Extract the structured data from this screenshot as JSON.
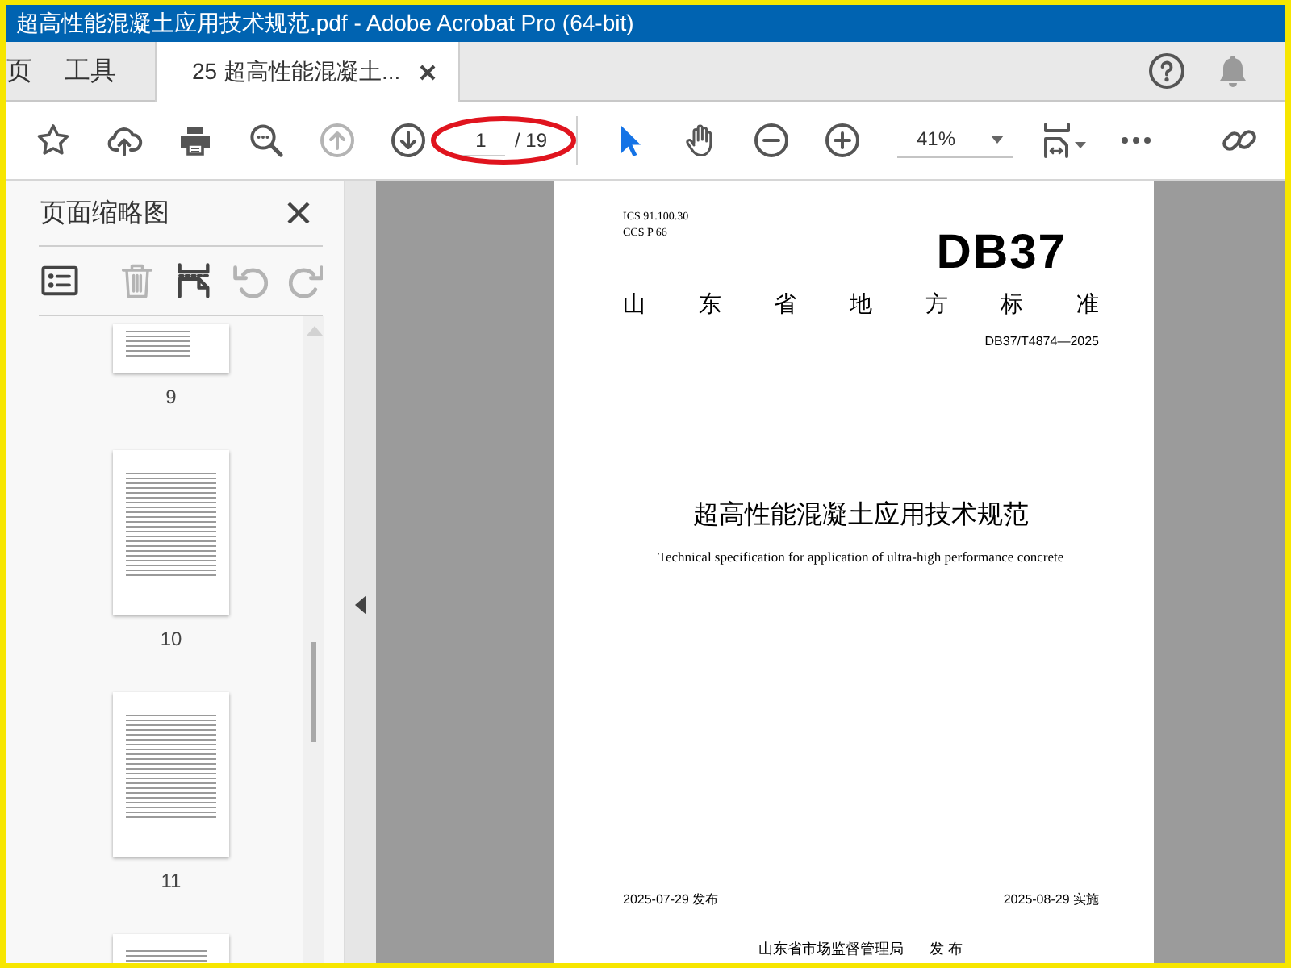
{
  "window": {
    "title": "超高性能混凝土应用技术规范.pdf - Adobe Acrobat Pro (64-bit)"
  },
  "tabs": [
    {
      "label": "页",
      "selected": false
    },
    {
      "label": "工具",
      "selected": false
    },
    {
      "label": "25 超高性能混凝土...",
      "selected": true
    }
  ],
  "toolbar": [
    {
      "kind": "star",
      "disabled": false
    },
    {
      "kind": "upload",
      "disabled": false
    },
    {
      "kind": "print",
      "disabled": false
    },
    {
      "kind": "zoom-search",
      "disabled": false
    },
    {
      "kind": "previous-page",
      "disabled": true
    },
    {
      "kind": "next-page",
      "disabled": false
    },
    {
      "kind": "page-field",
      "value": "1",
      "total": "/ 19"
    },
    {
      "kind": "divider"
    },
    {
      "kind": "select-tool",
      "selected": true
    },
    {
      "kind": "hand-tool",
      "selected": false
    },
    {
      "kind": "zoom-out",
      "disabled": false
    },
    {
      "kind": "zoom-in",
      "disabled": false
    },
    {
      "kind": "zoom-field",
      "value": "41%"
    },
    {
      "kind": "fit-page"
    },
    {
      "kind": "more"
    },
    {
      "kind": "link"
    }
  ],
  "annotations": [
    {
      "kind": "ellipse"
    }
  ],
  "thumbnail_panel": {
    "title": "页面缩略图",
    "tools": [
      {
        "kind": "options",
        "disabled": false
      },
      {
        "kind": "delete",
        "disabled": true
      },
      {
        "kind": "insert",
        "disabled": false
      },
      {
        "kind": "undo",
        "disabled": true
      },
      {
        "kind": "redo",
        "disabled": true
      }
    ],
    "pages": [
      {
        "label": "9"
      },
      {
        "label": "10"
      },
      {
        "label": "11"
      }
    ]
  },
  "document": {
    "ics": "ICS  91.100.30",
    "ccs": "CCS  P 66",
    "logo": "DB37",
    "category": "山 东 省 地 方 标 准",
    "number": "DB37/T4874—2025",
    "title": "超高性能混凝土应用技术规范",
    "subtitle": "Technical specification for application of ultra-high performance concrete",
    "issued": "2025-07-29 发布",
    "effective": "2025-08-29 实施",
    "issuer": "山东省市场监督管理局",
    "issuer_action": "发 布"
  }
}
